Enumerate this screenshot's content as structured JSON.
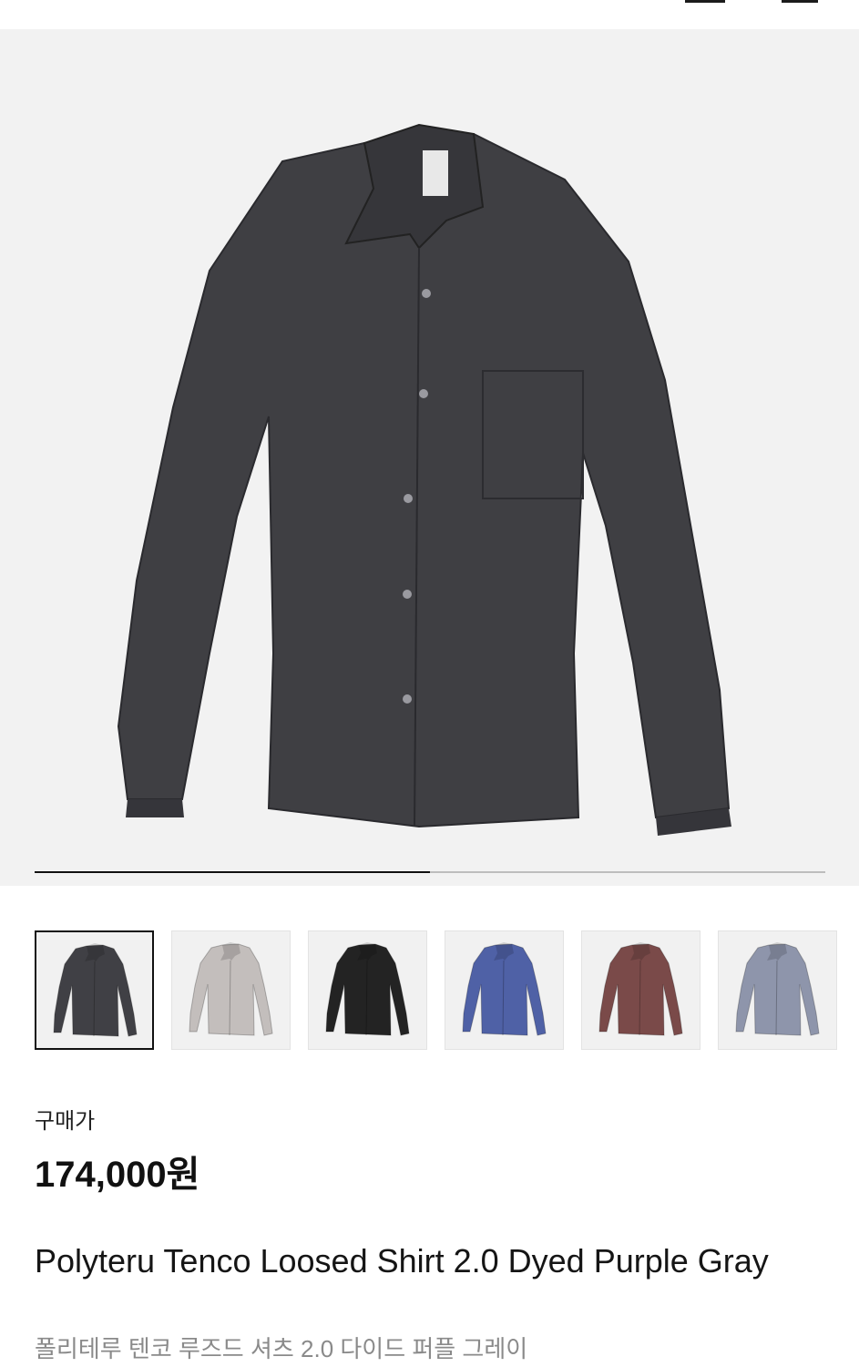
{
  "gallery": {
    "current_image": 1,
    "total_images": 2,
    "main_shirt_color": "#3f3f43"
  },
  "thumbnails": [
    {
      "name": "dyed-purple-gray",
      "color": "#404045",
      "selected": true
    },
    {
      "name": "light-gray",
      "color": "#c3bebc",
      "selected": false
    },
    {
      "name": "black",
      "color": "#232323",
      "selected": false
    },
    {
      "name": "blue",
      "color": "#4f61a6",
      "selected": false
    },
    {
      "name": "brown",
      "color": "#7a4a49",
      "selected": false
    },
    {
      "name": "gray-blue",
      "color": "#8e95ab",
      "selected": false
    }
  ],
  "product": {
    "price_label": "구매가",
    "price": "174,000원",
    "name_en": "Polyteru Tenco Loosed Shirt 2.0 Dyed Purple Gray",
    "name_ko": "폴리테루 텐코 루즈드 셔츠 2.0 다이드 퍼플 그레이"
  }
}
